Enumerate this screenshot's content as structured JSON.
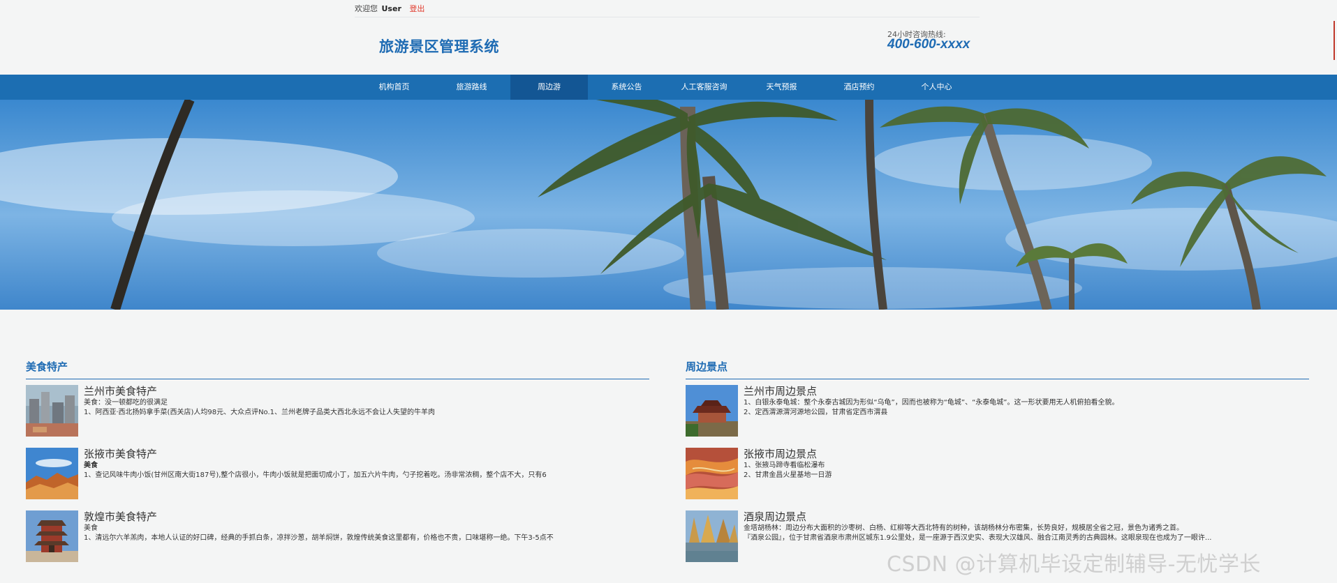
{
  "topbar": {
    "welcome": "欢迎您",
    "user": "User",
    "logout": "登出"
  },
  "header": {
    "title": "旅游景区管理系统",
    "hotline_label": "24小时咨询热线:",
    "hotline_number": "400-600-xxxx"
  },
  "nav": {
    "items": [
      {
        "label": "机构首页"
      },
      {
        "label": "旅游路线"
      },
      {
        "label": "周边游"
      },
      {
        "label": "系统公告"
      },
      {
        "label": "人工客服咨询"
      },
      {
        "label": "天气预报"
      },
      {
        "label": "酒店预约"
      },
      {
        "label": "个人中心"
      }
    ],
    "active_index": 2
  },
  "food": {
    "title": "美食特产",
    "items": [
      {
        "title": "兰州市美食特产",
        "line1": "美食：没一顿都吃的很满足",
        "line2": "1、阿西亚·西北扬妈拿手菜(西关店)人均98元、大众点评No.1、兰州老牌子品类大西北永远不会让人失望的牛羊肉",
        "line1_bold": false
      },
      {
        "title": "张掖市美食特产",
        "line1": "美食",
        "line2": "1、查记风味牛肉小饭(甘州区南大街187号),整个店很小，牛肉小饭就是把面切成小丁，加五六片牛肉，勺子挖着吃。汤非常浓稠，整个店不大，只有6",
        "line1_bold": true
      },
      {
        "title": "敦煌市美食特产",
        "line1": "美食",
        "line2": "1、清远尔六羊羔肉，本地人认证的好口碑，经典的手抓白条，凉拌沙葱，胡羊焖饼，敦煌传统美食这里都有，价格也不贵，口味堪称一绝。下午3-5点不",
        "line1_bold": false
      }
    ]
  },
  "spots": {
    "title": "周边景点",
    "items": [
      {
        "title": "兰州市周边景点",
        "line1": "1、白银永泰龟城：整个永泰古城因为形似“乌龟”，因而也被称为“龟城”、“永泰龟城”。这一形状要用无人机俯拍看全貌。",
        "line2": "2、定西渭源渭河源地公园，甘肃省定西市渭县"
      },
      {
        "title": "张掖市周边景点",
        "line1": "1、张掖马蹄寺看临松瀑布",
        "line2": "2、甘肃金昌火星基地一日游"
      },
      {
        "title": "酒泉周边景点",
        "line1": "金塔胡杨林：周边分布大面积的沙枣树、白杨、红柳等大西北特有的树种，该胡杨林分布密集，长势良好，规模居全省之冠，景色为诸秀之首。",
        "line2": "『酒泉公园』，位于甘肃省酒泉市肃州区城东1.9公里处，是一座源于西汉史实、表现大汉雄风、融合江南灵秀的古典园林。这眼泉现在也成为了一眼许..."
      }
    ]
  },
  "watermark": "CSDN @计算机毕设定制辅导-无忧学长",
  "colors": {
    "brand": "#1e6bb3",
    "nav": "#1c6eb2",
    "nav_active": "#135694",
    "logout": "#e0392b",
    "background": "#f4f5f5"
  }
}
